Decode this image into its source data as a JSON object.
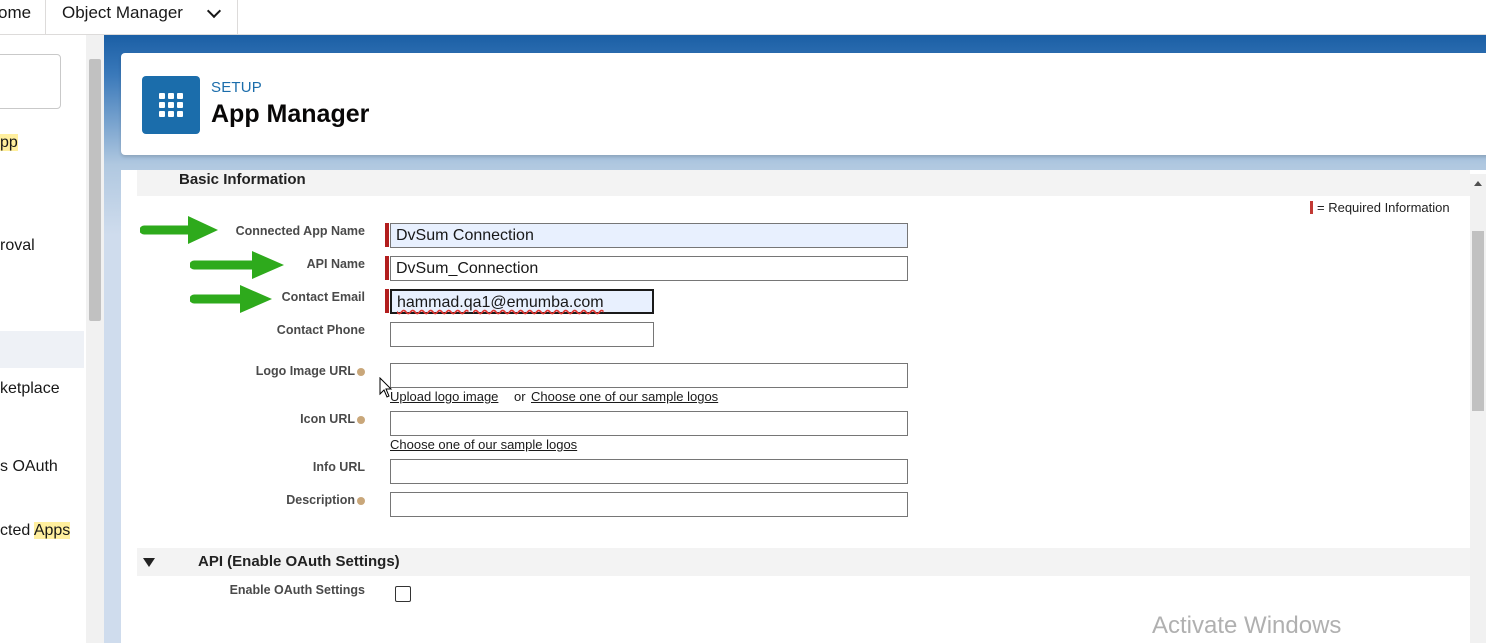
{
  "tabs": {
    "home": "ome",
    "object_manager": "Object Manager"
  },
  "sidebar": {
    "items": [
      {
        "text_a": "",
        "text_hl": "pp",
        "text_b": ""
      },
      {
        "text_a": "roval",
        "text_hl": "",
        "text_b": ""
      },
      {
        "text_a": "ketplace",
        "text_hl": "",
        "text_b": ""
      },
      {
        "text_a": "s OAuth",
        "text_hl": "",
        "text_b": ""
      },
      {
        "text_a": "cted ",
        "text_hl": "Apps",
        "text_b": ""
      }
    ]
  },
  "header": {
    "breadcrumb": "SETUP",
    "title": "App Manager",
    "icon": "app-grid-icon"
  },
  "basic_info": {
    "section_title": "Basic Information",
    "required_note": "= Required Information",
    "fields": {
      "connected_app_name": {
        "label": "Connected App Name",
        "value": "DvSum Connection"
      },
      "api_name": {
        "label": "API Name",
        "value": "DvSum_Connection"
      },
      "contact_email": {
        "label": "Contact Email",
        "value": "hammad.qa1@emumba.com"
      },
      "contact_phone": {
        "label": "Contact Phone",
        "value": ""
      },
      "logo_image_url": {
        "label": "Logo Image URL",
        "value": ""
      },
      "icon_url": {
        "label": "Icon URL",
        "value": ""
      },
      "info_url": {
        "label": "Info URL",
        "value": ""
      },
      "description": {
        "label": "Description",
        "value": ""
      }
    },
    "links": {
      "upload_logo": "Upload logo image",
      "or": "or",
      "choose_sample_logo": "Choose one of our sample logos",
      "choose_sample_icon": "Choose one of our sample logos"
    }
  },
  "api_section": {
    "section_title": "API (Enable OAuth Settings)",
    "enable_oauth_label": "Enable OAuth Settings",
    "enable_oauth_checked": false
  },
  "watermark": "Activate Windows",
  "colors": {
    "brand_blue": "#1b6dab",
    "required_red": "#b21e1e",
    "arrow_green": "#2eaa1c",
    "highlight_yellow": "#ffef9e"
  }
}
